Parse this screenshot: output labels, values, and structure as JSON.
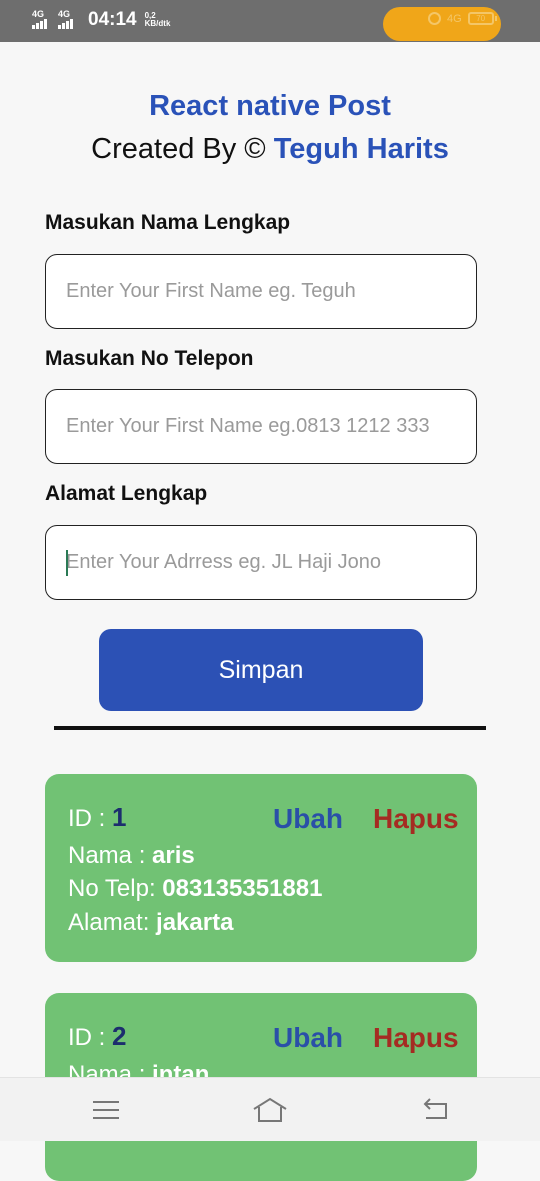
{
  "status_bar": {
    "network1": "4G",
    "network2": "4G",
    "time": "04:14",
    "speed_value": "0,2",
    "speed_unit": "KB/dtk",
    "network3": "4G",
    "battery": "70"
  },
  "header": {
    "title": "React native Post",
    "created_prefix": "Created By © ",
    "author": "Teguh Harits"
  },
  "form": {
    "name_label": "Masukan Nama Lengkap",
    "name_placeholder": "Enter Your First Name eg. Teguh",
    "phone_label": "Masukan No Telepon",
    "phone_placeholder": "Enter Your First Name eg.0813 1212 333",
    "address_label": "Alamat Lengkap",
    "address_placeholder": "Enter Your Adrress eg. JL Haji Jono",
    "save_label": "Simpan"
  },
  "records": [
    {
      "id_label": "ID : ",
      "id": "1",
      "edit_label": "Ubah",
      "delete_label": "Hapus",
      "name_label": "Nama : ",
      "name": "aris",
      "phone_label": "No Telp: ",
      "phone": "083135351881",
      "address_label": "Alamat: ",
      "address": "jakarta"
    },
    {
      "id_label": "ID : ",
      "id": "2",
      "edit_label": "Ubah",
      "delete_label": "Hapus",
      "name_label": "Nama : ",
      "name": "intan"
    }
  ],
  "nav": {
    "icons": [
      "menu-icon",
      "home-icon",
      "back-icon"
    ]
  },
  "colors": {
    "accent": "#2a52b8",
    "card": "#71c274",
    "delete": "#a52b22",
    "status_pill": "#f0a619"
  }
}
